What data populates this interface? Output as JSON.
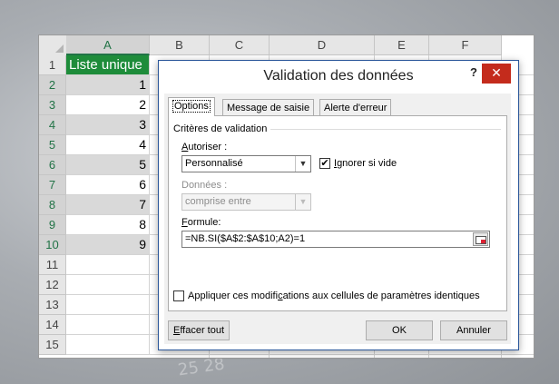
{
  "spreadsheet": {
    "corner": "",
    "columns": [
      "A",
      "B",
      "C",
      "D",
      "E",
      "F"
    ],
    "rows": [
      "1",
      "2",
      "3",
      "4",
      "5",
      "6",
      "7",
      "8",
      "9",
      "10",
      "11",
      "12",
      "13",
      "14",
      "15"
    ],
    "header_cell": "Liste unique",
    "values": [
      "1",
      "2",
      "3",
      "4",
      "5",
      "6",
      "7",
      "8",
      "9"
    ]
  },
  "dialog": {
    "title": "Validation des données",
    "help": "?",
    "close": "✕",
    "tabs": [
      "Options",
      "Message de saisie",
      "Alerte d'erreur"
    ],
    "criteria_label": "Critères de validation",
    "allow_label_prefix": "A",
    "allow_label_rest": "utoriser :",
    "allow_value": "Personnalisé",
    "ignore_blank_prefix": "I",
    "ignore_blank_rest": "gnorer si vide",
    "ignore_blank_checked": "✔",
    "data_label": "Données :",
    "data_value": "comprise entre",
    "formula_label_prefix": "F",
    "formula_label_rest": "ormule:",
    "formula_value": "=NB.SI($A$2:$A$10;A2)=1",
    "apply_label_part1": "Appliquer ces modifi",
    "apply_label_underline": "c",
    "apply_label_part2": "ations aux cellules de paramètres identiques",
    "clear_all_prefix": "E",
    "clear_all_rest": "ffacer tout",
    "ok": "OK",
    "cancel": "Annuler"
  },
  "background": {
    "deco_text": "25   28"
  },
  "colors": {
    "header_fill": "#1e8c3a",
    "selected_fill": "#d9d9d9",
    "close_button": "#c42b1c"
  }
}
